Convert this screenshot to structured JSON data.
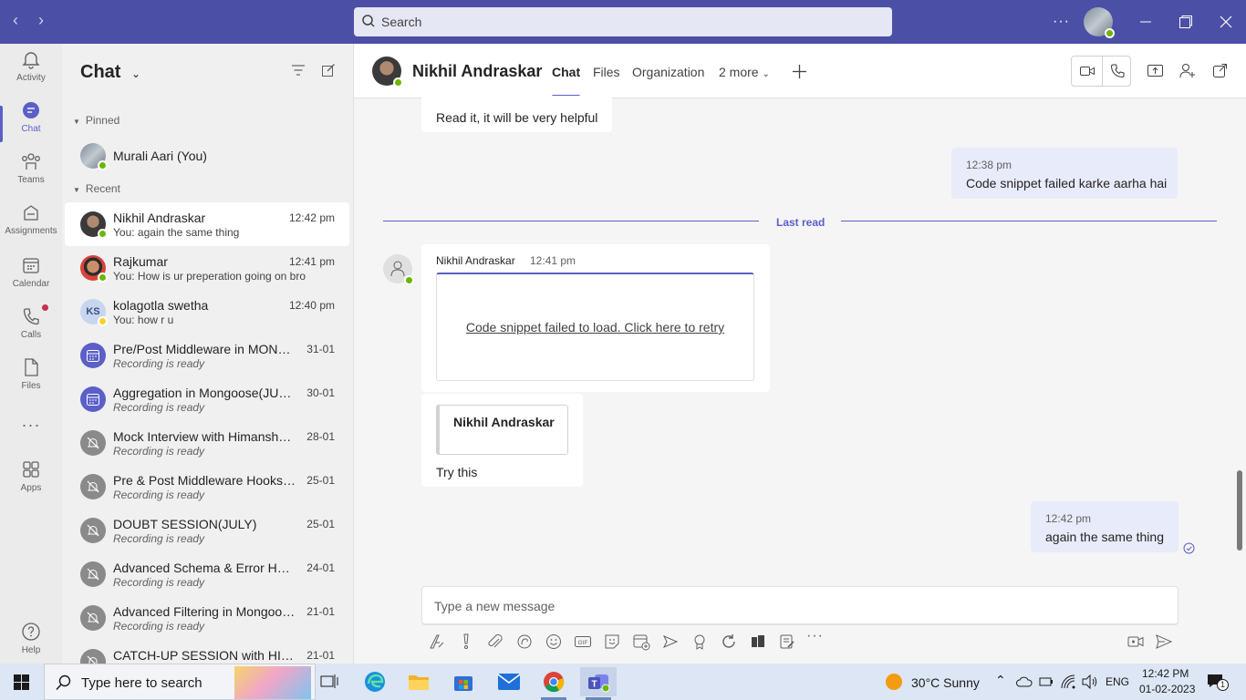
{
  "titlebar": {
    "search_placeholder": "Search",
    "more": "···"
  },
  "rail": [
    {
      "label": "Activity",
      "icon": "bell-icon"
    },
    {
      "label": "Chat",
      "icon": "chat-icon",
      "active": true
    },
    {
      "label": "Teams",
      "icon": "teams-icon"
    },
    {
      "label": "Assignments",
      "icon": "assignments-icon"
    },
    {
      "label": "Calendar",
      "icon": "calendar-icon"
    },
    {
      "label": "Calls",
      "icon": "phone-icon"
    },
    {
      "label": "Files",
      "icon": "file-icon"
    },
    {
      "label": "···",
      "icon": "more-icon"
    },
    {
      "label": "Apps",
      "icon": "apps-icon"
    },
    {
      "label": "Help",
      "icon": "help-icon"
    }
  ],
  "list": {
    "title": "Chat",
    "pinned_label": "Pinned",
    "recent_label": "Recent",
    "pinned": [
      {
        "name": "Murali Aari (You)"
      }
    ],
    "recent": [
      {
        "name": "Nikhil Andraskar",
        "preview": "You: again the same thing",
        "time": "12:42 pm",
        "selected": true,
        "avatar": "photo"
      },
      {
        "name": "Rajkumar",
        "preview": "You: How is ur preperation going on bro",
        "time": "12:41 pm",
        "avatar": "photo2"
      },
      {
        "name": "kolagotla swetha",
        "preview": "You: how r u",
        "time": "12:40 pm",
        "avatar": "initials",
        "initials": "KS"
      },
      {
        "name": "Pre/Post Middleware in MONG...",
        "preview": "Recording is ready",
        "time": "31-01",
        "avatar": "meeting"
      },
      {
        "name": "Aggregation in Mongoose(JULY)",
        "preview": "Recording is ready",
        "time": "30-01",
        "avatar": "meeting"
      },
      {
        "name": "Mock Interview with Himanshu ...",
        "preview": "Recording is ready",
        "time": "28-01",
        "avatar": "muted"
      },
      {
        "name": "Pre & Post Middleware Hooks(J...",
        "preview": "Recording is ready",
        "time": "25-01",
        "avatar": "muted"
      },
      {
        "name": "DOUBT SESSION(JULY)",
        "preview": "Recording is ready",
        "time": "25-01",
        "avatar": "muted"
      },
      {
        "name": "Advanced Schema & Error Han...",
        "preview": "Recording is ready",
        "time": "24-01",
        "avatar": "muted"
      },
      {
        "name": "Advanced Filtering in Mongoos...",
        "preview": "Recording is ready",
        "time": "21-01",
        "avatar": "muted"
      },
      {
        "name": "CATCH-UP SESSION with HIMA...",
        "preview": "",
        "time": "21-01",
        "avatar": "muted"
      }
    ]
  },
  "header": {
    "name": "Nikhil Andraskar",
    "tabs": [
      "Chat",
      "Files",
      "Organization",
      "2 more"
    ]
  },
  "messages": {
    "m1": "Read it, it will be very helpful",
    "m2_time": "12:38 pm",
    "m2_text": "Code snippet failed karke aarha hai",
    "last_read": "Last read",
    "m3_sender": "Nikhil Andraskar",
    "m3_time": "12:41 pm",
    "m3_snippet": "Code snippet failed to load. Click here to retry",
    "m4_card": "Nikhil Andraskar",
    "m4_text": "Try this",
    "m5_time": "12:42 pm",
    "m5_text": "again the same thing"
  },
  "composer": {
    "placeholder": "Type a new message"
  },
  "taskbar": {
    "search": "Type here to search",
    "weather": "30°C  Sunny",
    "lang": "ENG",
    "time": "12:42 PM",
    "date": "01-02-2023",
    "notif": "1"
  },
  "colors": {
    "brand": "#4b4fa5",
    "accent": "#5b5fc7",
    "online": "#6bb700"
  }
}
